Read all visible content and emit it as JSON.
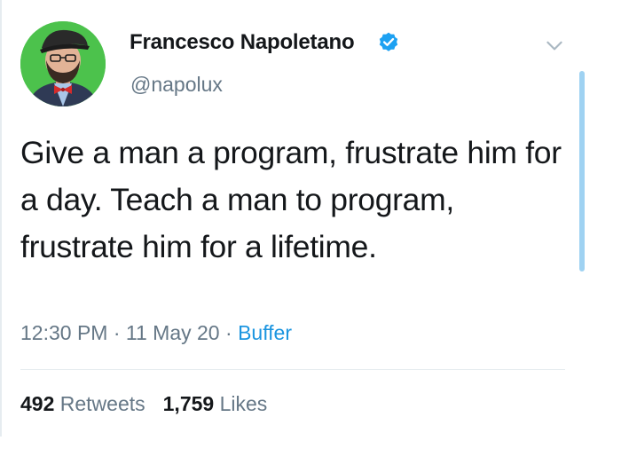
{
  "author": {
    "display_name": "Francesco Napoletano",
    "handle": "@napolux",
    "verified": true,
    "verified_color": "#1da1f2"
  },
  "tweet": {
    "text": "Give a man a program, frustrate him for a day. Teach a man to program, frustrate him for a lifetime."
  },
  "meta": {
    "time": "12:30 PM",
    "separator1": " · ",
    "date": "11 May 20",
    "separator2": " · ",
    "source": "Buffer"
  },
  "stats": {
    "retweets_count": "492",
    "retweets_label": "Retweets",
    "likes_count": "1,759",
    "likes_label": "Likes"
  },
  "colors": {
    "text": "#14171a",
    "secondary": "#657786",
    "link": "#1b95e0",
    "scrollbar": "#9fd2f2",
    "avatar_background": "#4cc24c"
  },
  "icons": {
    "caret": "chevron-down-icon",
    "verified": "verified-badge-icon"
  }
}
